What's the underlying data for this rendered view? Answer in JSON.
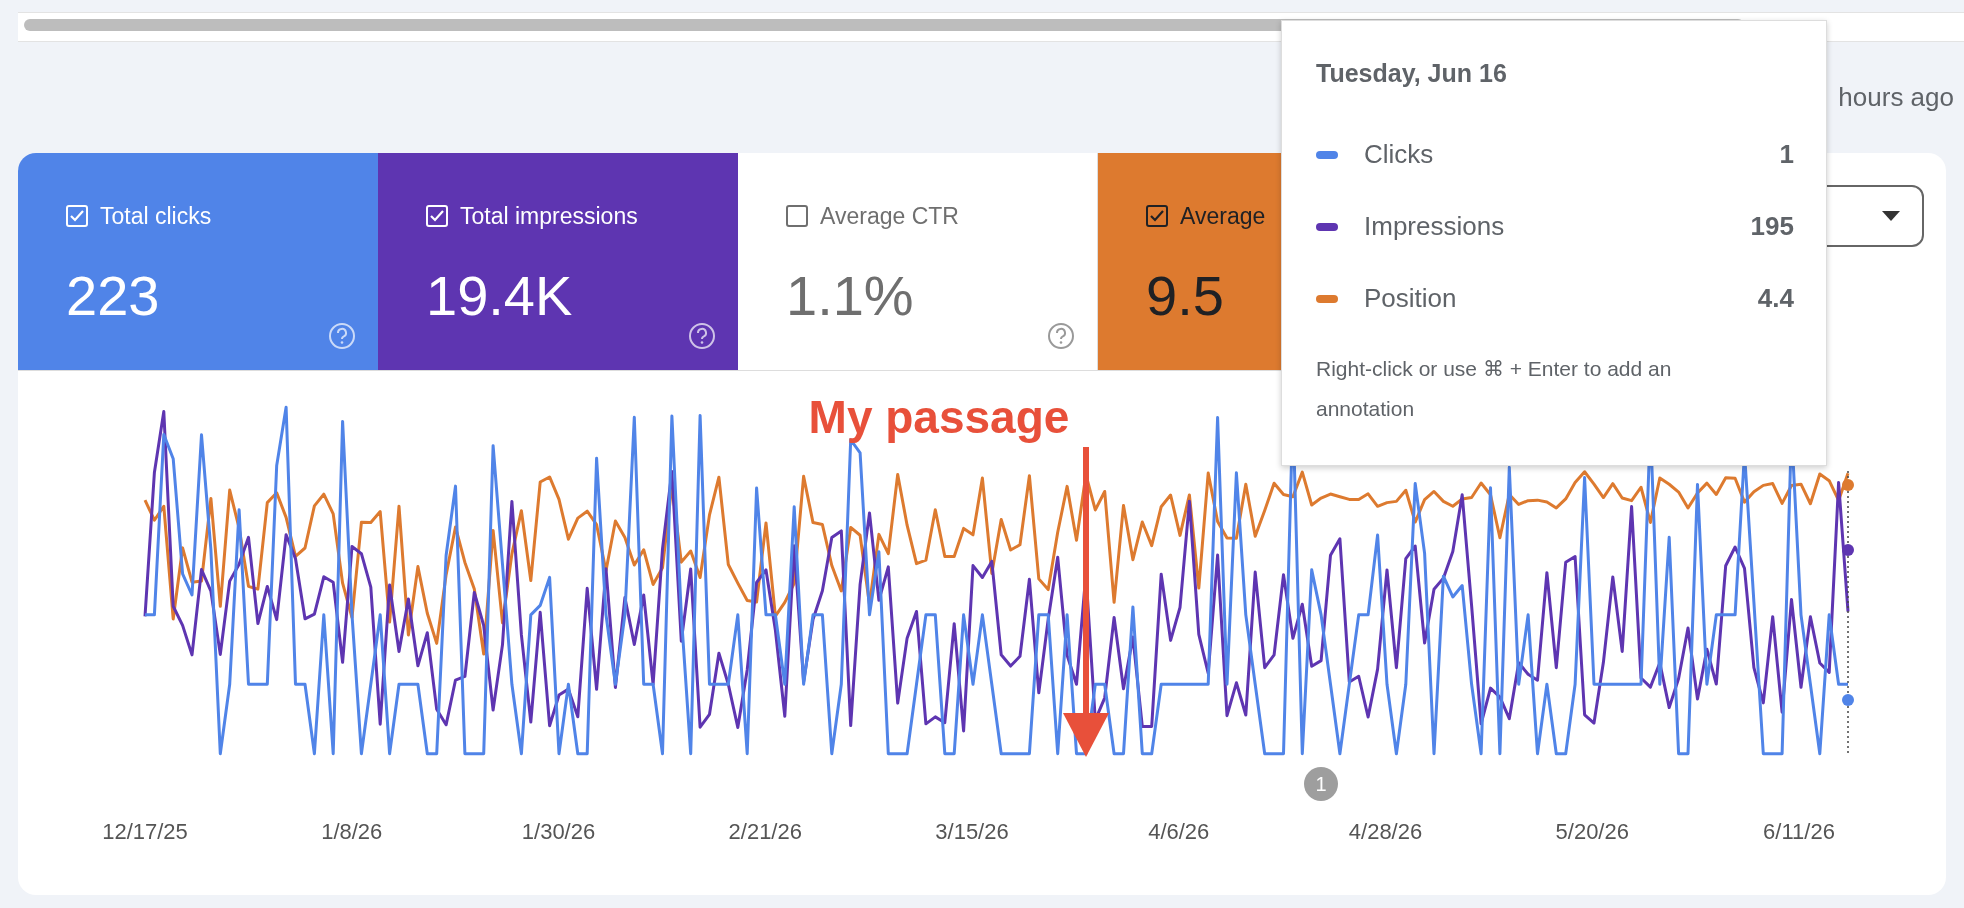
{
  "last_update": "hours ago",
  "metrics": [
    {
      "label": "Total clicks",
      "value": "223",
      "checked": true,
      "color": "#5084e8"
    },
    {
      "label": "Total impressions",
      "value": "19.4K",
      "checked": true,
      "color": "#5e35b1"
    },
    {
      "label": "Average CTR",
      "value": "1.1%",
      "checked": false
    },
    {
      "label": "Average",
      "value": "9.5",
      "checked": true,
      "color": "#dd7a2f"
    }
  ],
  "annotation": {
    "text": "My passage"
  },
  "x_labels": [
    "12/17/25",
    "1/8/26",
    "1/30/26",
    "2/21/26",
    "3/15/26",
    "4/6/26",
    "4/28/26",
    "5/20/26",
    "6/11/26"
  ],
  "annotation_marker": "1",
  "tooltip": {
    "title": "Tuesday, Jun 16",
    "rows": [
      {
        "label": "Clicks",
        "value": "1",
        "color": "#5084e8"
      },
      {
        "label": "Impressions",
        "value": "195",
        "color": "#5e35b1"
      },
      {
        "label": "Position",
        "value": "4.4",
        "color": "#dd7a2f"
      }
    ],
    "hint": "Right-click or use ⌘ + Enter to add an annotation"
  }
}
